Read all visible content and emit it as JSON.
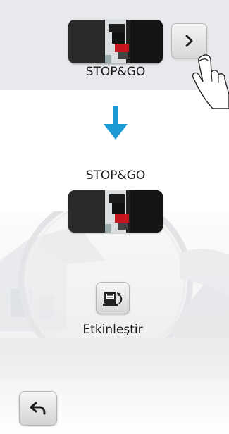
{
  "top_panel": {
    "device_label": "STOP&GO",
    "next_icon": "chevron-right-icon",
    "hand_icon": "tapping-hand-icon"
  },
  "flow": {
    "arrow_icon": "arrow-down-icon",
    "arrow_color": "#1b9ad4"
  },
  "device": {
    "label": "STOP&GO"
  },
  "action": {
    "activate_label": "Etkinleştir",
    "activate_icon": "device-off-rotate-icon"
  },
  "footer": {
    "back_icon": "back-arrow-icon"
  },
  "colors": {
    "panel_bg": "#e7e9ec",
    "accent": "#1b9ad4"
  }
}
